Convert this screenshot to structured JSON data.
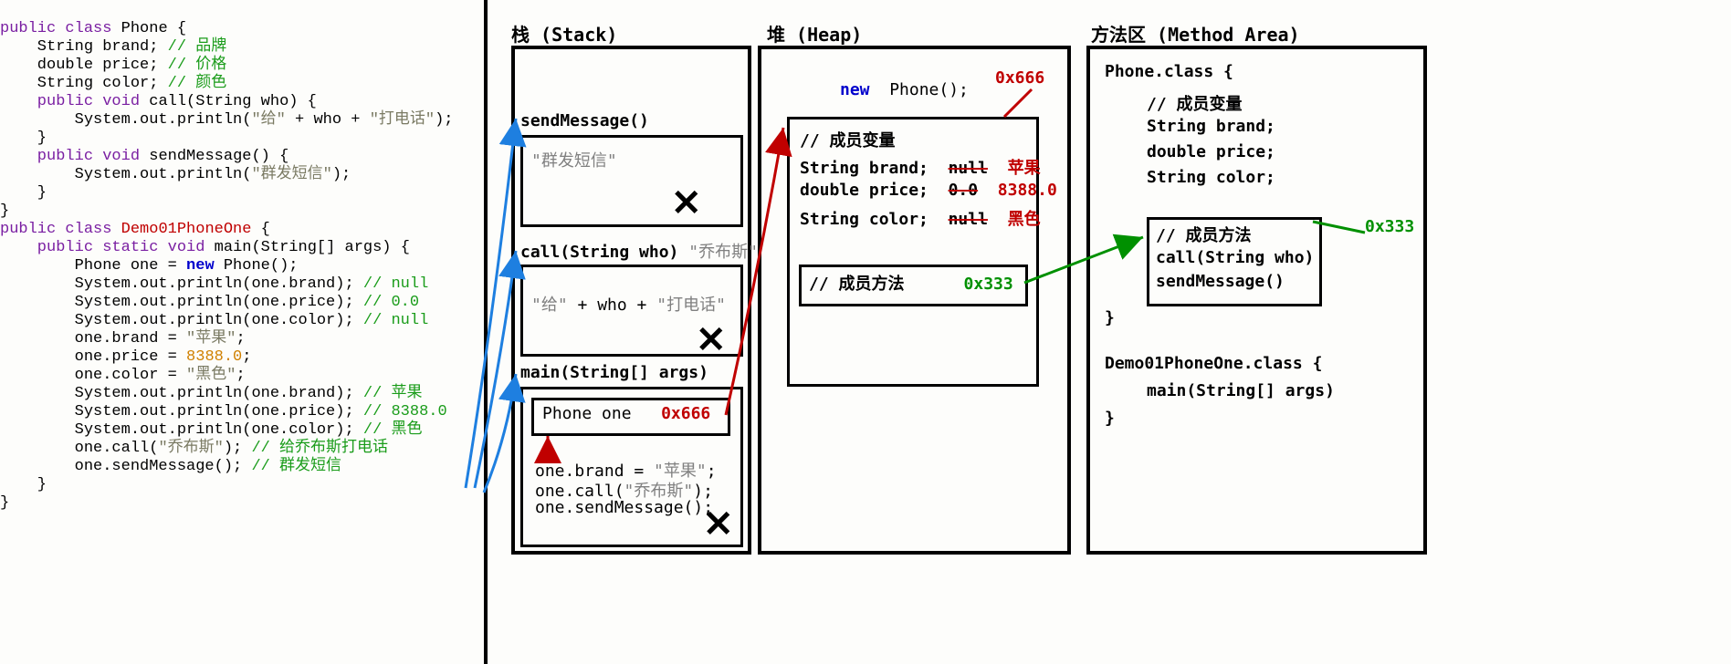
{
  "code": {
    "l1_pub": "public",
    "l1_cls": "class",
    "l1_name": "Phone",
    "l1_br": "{",
    "l2": "    String brand; ",
    "l2_c": "// 品牌",
    "l3": "    double price; ",
    "l3_c": "// 价格",
    "l4": "    String color; ",
    "l4_c": "// 颜色",
    "l5_pub": "    public",
    "l5_void": "void",
    "l5_sig": "call(String who) {",
    "l6a": "        System.out.println(",
    "l6s1": "\"给\"",
    "l6p1": " + who + ",
    "l6s2": "\"打电话\"",
    "l6b": ");",
    "l7": "    }",
    "l8_pub": "    public",
    "l8_void": "void",
    "l8_sig": "sendMessage() {",
    "l9a": "        System.out.println(",
    "l9s": "\"群发短信\"",
    "l9b": ");",
    "l10": "    }",
    "l11": "}",
    "l12_pub": "public",
    "l12_cls": "class",
    "l12_name": "Demo01PhoneOne",
    "l12_br": "{",
    "l13_pub": "    public",
    "l13_static": "static",
    "l13_void": "void",
    "l13_sig": "main(String[] args) {",
    "l14a": "        Phone one = ",
    "l14_new": "new",
    "l14b": " Phone();",
    "l15a": "        System.out.println(one.brand); ",
    "l15c": "// null",
    "l16a": "        System.out.println(one.price); ",
    "l16c": "// 0.0",
    "l17a": "        System.out.println(one.color); ",
    "l17c": "// null",
    "l18a": "        one.brand = ",
    "l18s": "\"苹果\"",
    "l18b": ";",
    "l19a": "        one.price = ",
    "l19n": "8388.0",
    "l19b": ";",
    "l20a": "        one.color = ",
    "l20s": "\"黑色\"",
    "l20b": ";",
    "l21a": "        System.out.println(one.brand); ",
    "l21c": "// 苹果",
    "l22a": "        System.out.println(one.price); ",
    "l22c": "// 8388.0",
    "l23a": "        System.out.println(one.color); ",
    "l23c": "// 黑色",
    "l24a": "        one.call(",
    "l24s": "\"乔布斯\"",
    "l24b": "); ",
    "l24c": "// 给乔布斯打电话",
    "l25a": "        one.sendMessage(); ",
    "l25c": "// 群发短信",
    "l26": "    }",
    "l27": "}"
  },
  "titles": {
    "stack": "栈  (Stack)",
    "heap": "堆  (Heap)",
    "method": "方法区  (Method Area)"
  },
  "stack": {
    "sm": "sendMessage()",
    "sm_txt": "\"群发短信\"",
    "call": "call(String who)",
    "call_arg": "\"乔布斯\"",
    "call_txt1": "\"给\"",
    "call_plus": " + who + ",
    "call_txt2": "\"打电话\"",
    "main": "main(String[] args)",
    "main_var": "Phone  one",
    "main_addr": "0x666",
    "main_l1": "one.brand = ",
    "main_s1": "\"苹果\"",
    "main_e1": ";",
    "main_l2": "one.call(",
    "main_s2": "\"乔布斯\"",
    "main_e2": ");",
    "main_l3": "one.sendMessage();"
  },
  "heap": {
    "new": "new",
    "phone": "Phone();",
    "addr": "0x666",
    "mv": "// 成员变量",
    "f1": "String brand;",
    "f1o": "null",
    "f1n": "苹果",
    "f2": "double price;",
    "f2o": "0.0",
    "f2n": "8388.0",
    "f3": "String color;",
    "f3o": "null",
    "f3n": "黑色",
    "mm": "// 成员方法",
    "mm_addr": "0x333"
  },
  "methodArea": {
    "pc": "Phone.class {",
    "mv": "// 成员变量",
    "f1": "String brand;",
    "f2": "double price;",
    "f3": "String color;",
    "mm": "// 成员方法",
    "m1": "call(String who)",
    "m2": "sendMessage()",
    "end": "}",
    "addr": "0x333",
    "dc": "Demo01PhoneOne.class {",
    "dm": "main(String[] args)",
    "dend": "}"
  }
}
